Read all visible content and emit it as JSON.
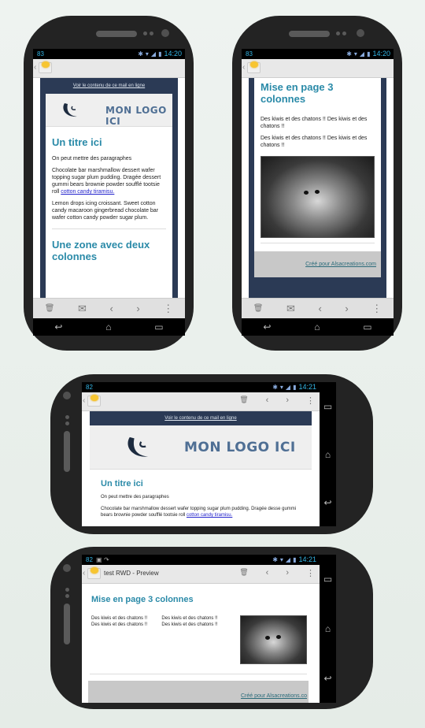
{
  "phones": {
    "portrait_1": {
      "status": {
        "left": "83",
        "time": "14:20"
      },
      "mail": {
        "view_online": "Voir le contenu de ce mail en ligne",
        "logo_text": "MON LOGO ICI",
        "title": "Un titre ici",
        "para1": "On peut mettre des paragraphes",
        "para2": "Chocolate bar marshmallow dessert wafer topping sugar plum pudding. Dragée dessert gummi bears brownie powder soufflé tootsie roll ",
        "para2_link": "cotton candy tiramisu.",
        "para3": "Lemon drops icing croissant. Sweet cotton candy macaroon gingerbread chocolate bar wafer cotton candy powder sugar plum.",
        "section_title": "Une zone avec deux colonnes"
      }
    },
    "portrait_2": {
      "status": {
        "left": "83",
        "time": "14:20"
      },
      "mail": {
        "title": "Mise en page 3 colonnes",
        "para1": "Des kiwis et des chatons !! Des kiwis et des chatons !!",
        "para2": "Des kiwis et des chatons !! Des kiwis et des chatons !!",
        "footer_link": "Créé pour Alsacreations.com"
      }
    },
    "landscape_1": {
      "status": {
        "left": "82",
        "time": "14:21"
      },
      "mail": {
        "view_online": "Voir le contenu de ce mail en ligne",
        "logo_text": "MON LOGO ICI",
        "title": "Un titre ici",
        "para1": "On peut mettre des paragraphes",
        "para2": "Chocolate bar marshmallow dessert wafer topping sugar plum pudding. Dragée desse gummi bears brownie powder soufflé tootsie roll ",
        "para2_link": "cotton candy tiramisu."
      }
    },
    "landscape_2": {
      "status": {
        "left": "82",
        "time": "14:21"
      },
      "actionbar_title": "test RWD - Preview",
      "mail": {
        "title": "Mise en page 3 colonnes",
        "col1": "Des kiwis et des chatons !! Des kiwis et des chatons !!",
        "col2": "Des kiwis et des chatons !! Des kiwis et des chatons !!",
        "footer_link": "Créé pour Alsacreations.co"
      }
    }
  },
  "icons": {
    "back": "‹",
    "trash": "🗑",
    "mail": "✉",
    "prev": "‹",
    "next": "›",
    "menu": "⋮",
    "nav_back": "↩",
    "nav_home": "⌂",
    "nav_recent": "▭"
  },
  "colors": {
    "title_teal": "#2a8aa8",
    "mail_frame_navy": "#2b3a55",
    "logo_blue": "#4f6f94",
    "status_blue": "#33b5e5"
  }
}
